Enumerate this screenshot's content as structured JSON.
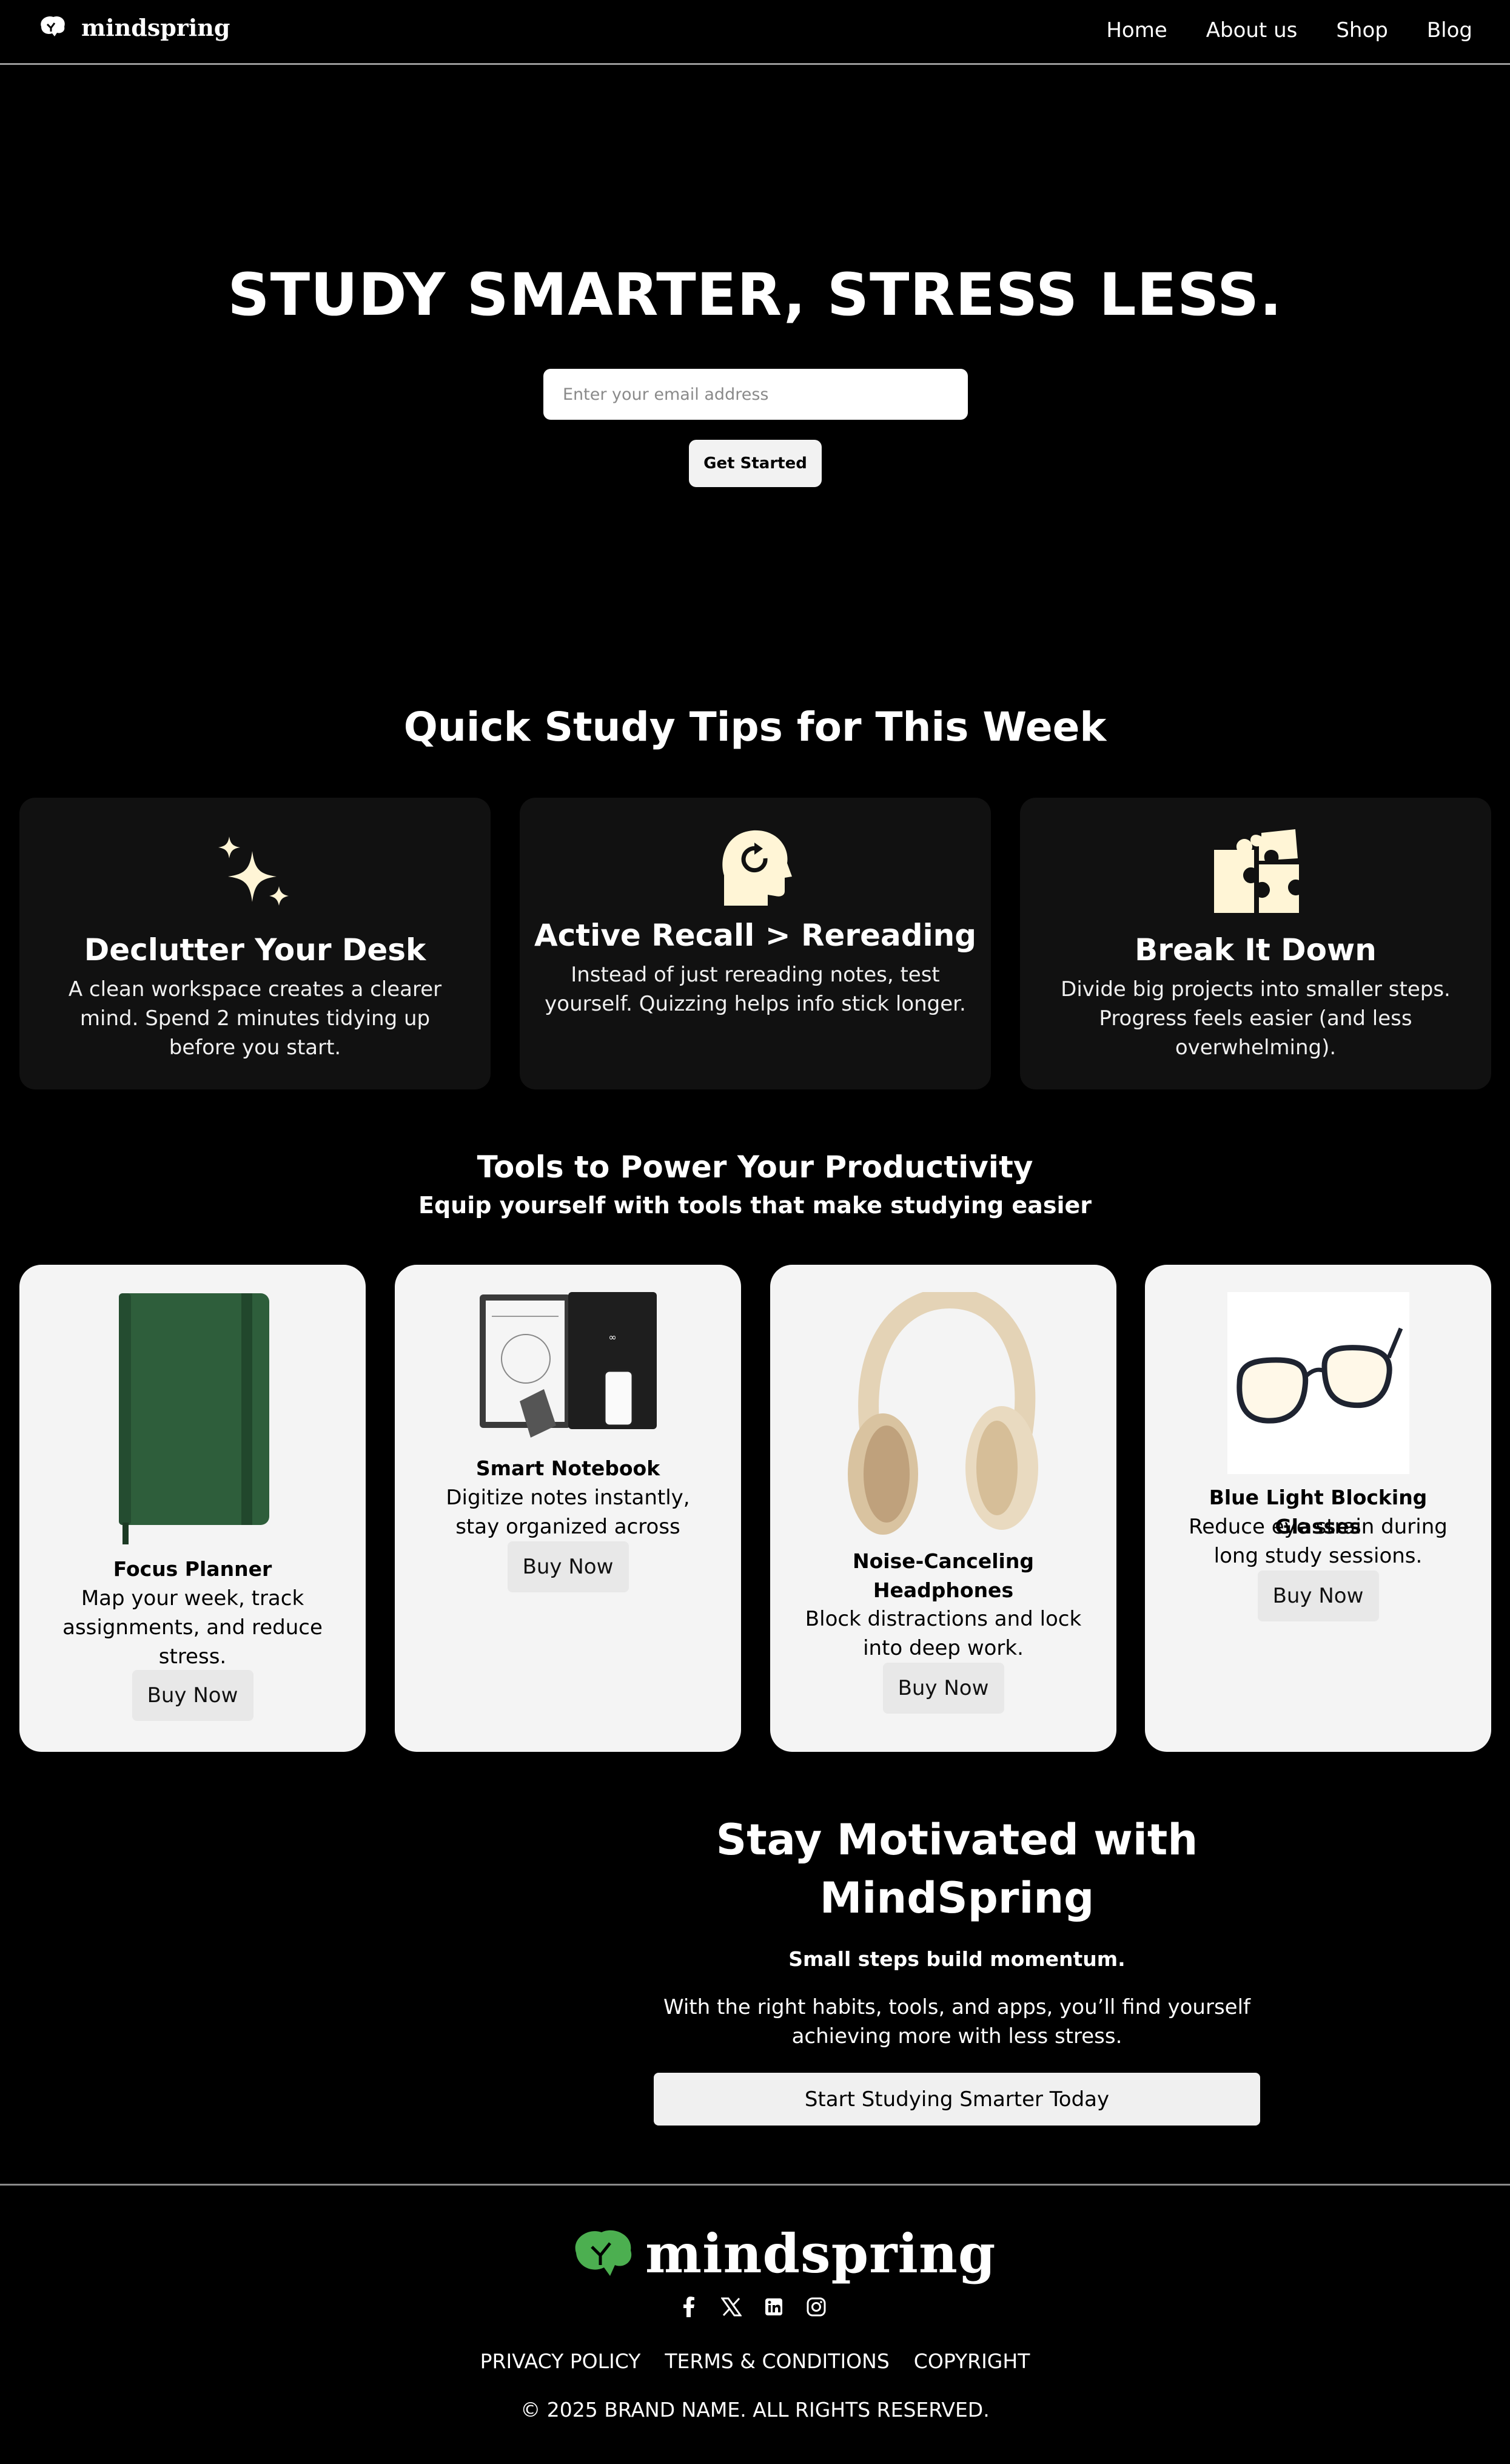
{
  "nav": {
    "brand": "mindspring",
    "links": [
      "Home",
      "About us",
      "Shop",
      "Blog"
    ]
  },
  "hero": {
    "title": "STUDY SMARTER, STRESS LESS.",
    "email_placeholder": "Enter your email address",
    "cta": "Get Started"
  },
  "tips": {
    "title": "Quick Study Tips for This Week",
    "items": [
      {
        "icon": "sparkles-icon",
        "title": "Declutter Your Desk",
        "text": "A clean workspace creates a clearer mind. Spend 2 minutes tidying up before you start."
      },
      {
        "icon": "head-refresh-icon",
        "title": "Active Recall > Rereading",
        "text": "Instead of just rereading notes, test yourself. Quizzing helps info stick longer."
      },
      {
        "icon": "puzzle-icon",
        "title": "Break It Down",
        "text": "Divide big projects into smaller steps. Progress feels easier (and less overwhelming)."
      }
    ],
    "icon_color": "#FFF5D6"
  },
  "tools": {
    "title": "Tools to Power Your Productivity",
    "subtitle": "Equip yourself with tools that make studying easier",
    "buy_label": "Buy Now",
    "items": [
      {
        "name": "Focus Planner",
        "desc": "Map your week, track assignments, and reduce stress."
      },
      {
        "name": "Smart Notebook",
        "desc": "Digitize notes instantly, stay organized across subjects."
      },
      {
        "name": "Noise-Canceling Headphones",
        "desc": "Block distractions and lock into deep work."
      },
      {
        "name": "Blue Light Blocking Glasses",
        "desc": "Reduce eye strain during long study sessions."
      }
    ]
  },
  "motivation": {
    "title": "Stay Motivated with MindSpring",
    "subtitle": "Small steps build momentum.",
    "text": "With the right habits, tools, and apps, you’ll find yourself achieving more with less stress.",
    "cta": "Start Studying Smarter Today"
  },
  "footer": {
    "brand": "mindspring",
    "brand_color": "#4CAF50",
    "socials": [
      "facebook-icon",
      "x-icon",
      "linkedin-icon",
      "instagram-icon"
    ],
    "links": [
      "PRIVACY POLICY",
      "TERMS & CONDITIONS",
      "COPYRIGHT"
    ],
    "copyright": "© 2025 BRAND NAME. ALL RIGHTS RESERVED."
  }
}
